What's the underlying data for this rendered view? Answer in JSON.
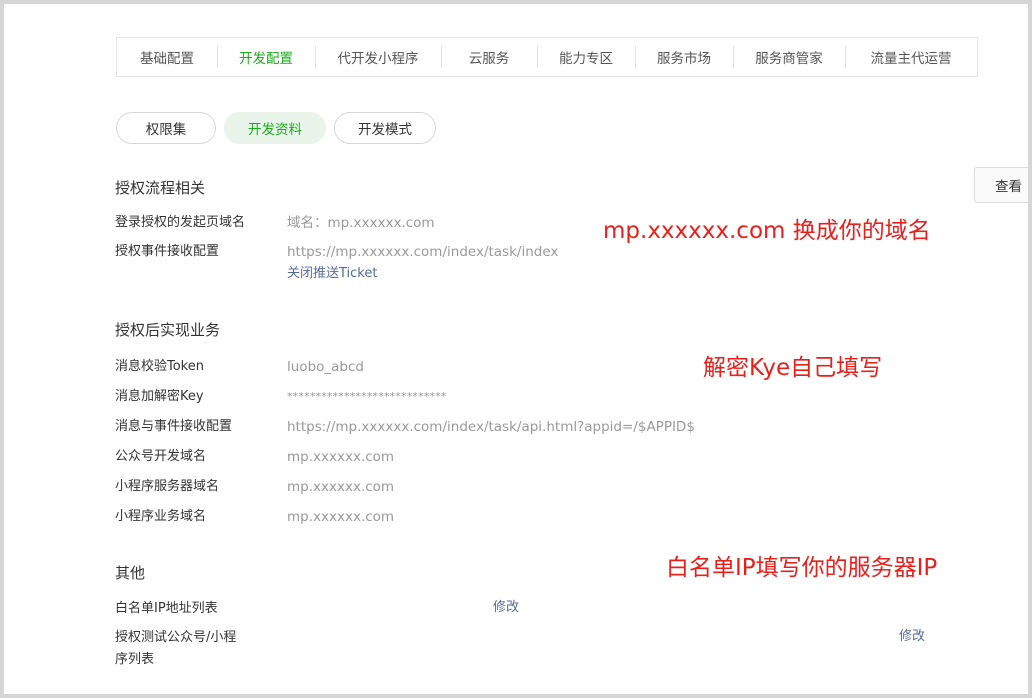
{
  "tabs": [
    {
      "label": "基础配置",
      "active": false
    },
    {
      "label": "开发配置",
      "active": true
    },
    {
      "label": "代开发小程序",
      "active": false
    },
    {
      "label": "云服务",
      "active": false
    },
    {
      "label": "能力专区",
      "active": false
    },
    {
      "label": "服务市场",
      "active": false
    },
    {
      "label": "服务商管家",
      "active": false
    },
    {
      "label": "流量主代运营",
      "active": false
    }
  ],
  "subtabs": [
    {
      "label": "权限集",
      "active": false
    },
    {
      "label": "开发资料",
      "active": true
    },
    {
      "label": "开发模式",
      "active": false
    }
  ],
  "side_button": {
    "label": "查看"
  },
  "auth_flow": {
    "title": "授权流程相关",
    "login_domain_label": "登录授权的发起页域名",
    "login_domain_value": "域名：mp.xxxxxx.com",
    "event_config_label": "授权事件接收配置",
    "event_config_value": "https://mp.xxxxxx.com/index/task/index",
    "ticket_link": "关闭推送Ticket"
  },
  "business": {
    "title": "授权后实现业务",
    "rows": [
      {
        "label": "消息校验Token",
        "value": "luobo_abcd"
      },
      {
        "label": "消息加解密Key",
        "value": "****************************"
      },
      {
        "label": "消息与事件接收配置",
        "value": "https://mp.xxxxxx.com/index/task/api.html?appid=/$APPID$"
      },
      {
        "label": "公众号开发域名",
        "value": "mp.xxxxxx.com"
      },
      {
        "label": "小程序服务器域名",
        "value": "mp.xxxxxx.com"
      },
      {
        "label": "小程序业务域名",
        "value": "mp.xxxxxx.com"
      }
    ]
  },
  "other": {
    "title": "其他",
    "whitelist_label": "白名单IP地址列表",
    "whitelist_action": "修改",
    "test_list_label_line1": "授权测试公众号/小程",
    "test_list_label_line2": "序列表",
    "test_list_action": "修改"
  },
  "annotations": {
    "domain": "mp.xxxxxx.com  换成你的域名",
    "key": "解密Kye自己填写",
    "ip": "白名单IP填写你的服务器IP",
    "color": "#e8201c"
  },
  "colors": {
    "accent": "#1aad19",
    "link": "#576b95"
  }
}
